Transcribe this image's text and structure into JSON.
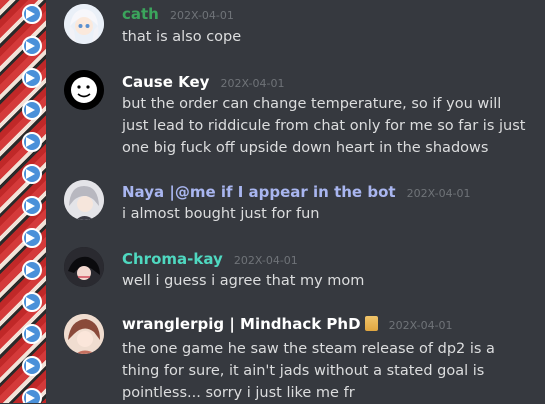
{
  "colors": {
    "background": "#36393f",
    "text": "#dcddde",
    "timestamp": "#6f7378"
  },
  "messages": [
    {
      "author": "cath",
      "author_color": "#3ba55c",
      "timestamp": "202X-04-01",
      "text": "that is also cope",
      "avatar_icon": "anime-avatar-white-hair"
    },
    {
      "author": "Cause Key",
      "author_color": "#ffffff",
      "timestamp": "202X-04-01",
      "text": "but the order can change temperature, so if you will just lead to riddicule from chat only for me so far is just one big fuck off upside down heart in the shadows",
      "avatar_icon": "face-icon"
    },
    {
      "author": "Naya |@me if I appear in the bot",
      "author_color": "#a9b6f0",
      "timestamp": "202X-04-01",
      "text": "i almost bought just for fun",
      "avatar_icon": "anime-avatar-grey-hair"
    },
    {
      "author": "Chroma-kay",
      "author_color": "#4fd8c0",
      "timestamp": "202X-04-01",
      "text": "well i guess i agree that my mom",
      "avatar_icon": "anime-avatar-dark"
    },
    {
      "author": "wranglerpig | Mindhack PhD",
      "author_color": "#ffffff",
      "timestamp": "202X-04-01",
      "text": "the one game he saw the steam release of dp2 is a thing for sure, it ain't jads without a stated goal is pointless... sorry i just like me fr",
      "avatar_icon": "anime-avatar-brown-hair",
      "role_icon": "scroll-icon"
    }
  ]
}
